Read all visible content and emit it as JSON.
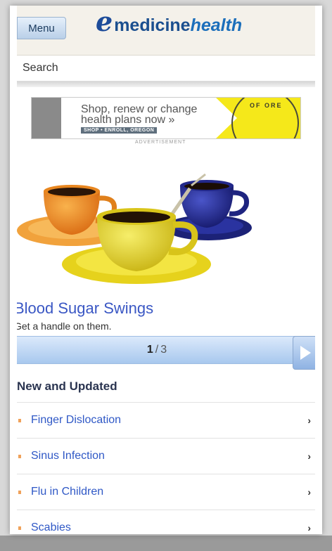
{
  "header": {
    "menu_label": "Menu",
    "logo": {
      "prefix": "e",
      "part1": "medicine",
      "part2": "health"
    }
  },
  "search": {
    "label": "Search"
  },
  "ad": {
    "line1": "Shop, renew or change",
    "line2": "health plans now »",
    "cta": "SHOP • ENROLL, OREGON",
    "seal_text": "OF ORE",
    "label": "ADVERTISEMENT"
  },
  "carousel": {
    "title": "Blood Sugar Swings",
    "subtitle": "Get a handle on them.",
    "current": "1",
    "separator": "/",
    "total": "3"
  },
  "section": {
    "title": "New and Updated"
  },
  "list": [
    {
      "label": "Finger Dislocation"
    },
    {
      "label": "Sinus Infection"
    },
    {
      "label": "Flu in Children"
    },
    {
      "label": "Scabies"
    }
  ],
  "colors": {
    "accent": "#2f58c6",
    "ad_yellow": "#f5e81a",
    "pager_blue": "#a8c8ee",
    "bullet": "#f0a25a"
  }
}
